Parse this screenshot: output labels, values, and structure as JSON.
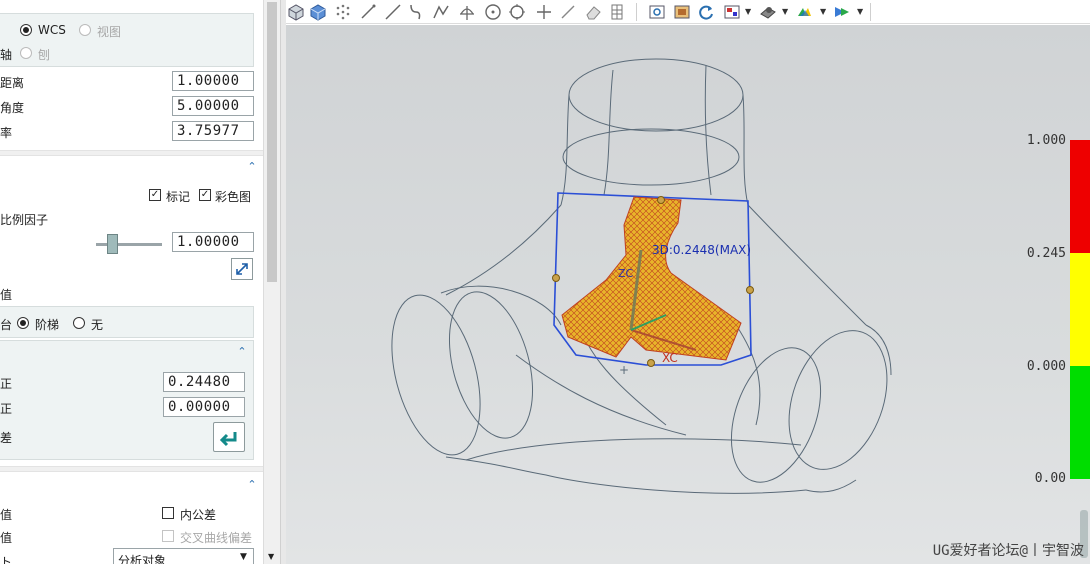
{
  "panel": {
    "coord": {
      "row1_label": "",
      "wcs_label": "WCS",
      "view_label": "视图",
      "row2_label": "轴",
      "plane_label": "刨"
    },
    "params": {
      "dist_label": "距离",
      "dist_value": "1.00000",
      "angle_label": "角度",
      "angle_value": "5.00000",
      "rate_label": "率",
      "rate_value": "3.75977"
    },
    "display": {
      "marker_label": "标记",
      "colormap_label": "彩色图",
      "scale_label": "比例因子",
      "scale_value": "1.00000"
    },
    "levels": {
      "title": "值",
      "left_label": "台",
      "step_label": "阶梯",
      "none_label": "无"
    },
    "tolerance": {
      "pos_label": "正",
      "pos_value": "0.24480",
      "neg_label": "正",
      "neg_value": "0.00000",
      "diff_label": "差"
    },
    "bottom": {
      "row1_label": "值",
      "inner_tol_label": "内公差",
      "row2_label": "值",
      "cross_curve_label": "交叉曲线偏差",
      "row3_label": "ト",
      "select_value": "分析对象"
    }
  },
  "viewport": {
    "annotation": "3D:0.2448(MAX)",
    "axis_xc": "XC",
    "axis_zc": "ZC",
    "legend": [
      "1.000",
      "0.245",
      "0.000",
      "0.00"
    ],
    "colors": {
      "red": "#ee0000",
      "yellow": "#ffff00",
      "green": "#00dd00",
      "mesh": "#e8b42a",
      "wire": "#5a6a78",
      "selection": "#2b4fd6"
    },
    "watermark": "UG爱好者论坛@丨宇智波"
  },
  "toolbar": {
    "icons": [
      "cube-shaded-icon",
      "cube-solid-icon",
      "point-cloud-icon",
      "line-icon",
      "line2-icon",
      "spline-icon",
      "polyline-icon",
      "arc-icon",
      "circle-icon",
      "circle2-icon",
      "cross-icon",
      "slash-icon",
      "eraser-icon",
      "grid-icon",
      "zoom-fit-icon",
      "render-icon",
      "rotate-icon",
      "view-layout-icon",
      "shading-icon",
      "edge-color-icon",
      "display-mode-icon"
    ]
  }
}
